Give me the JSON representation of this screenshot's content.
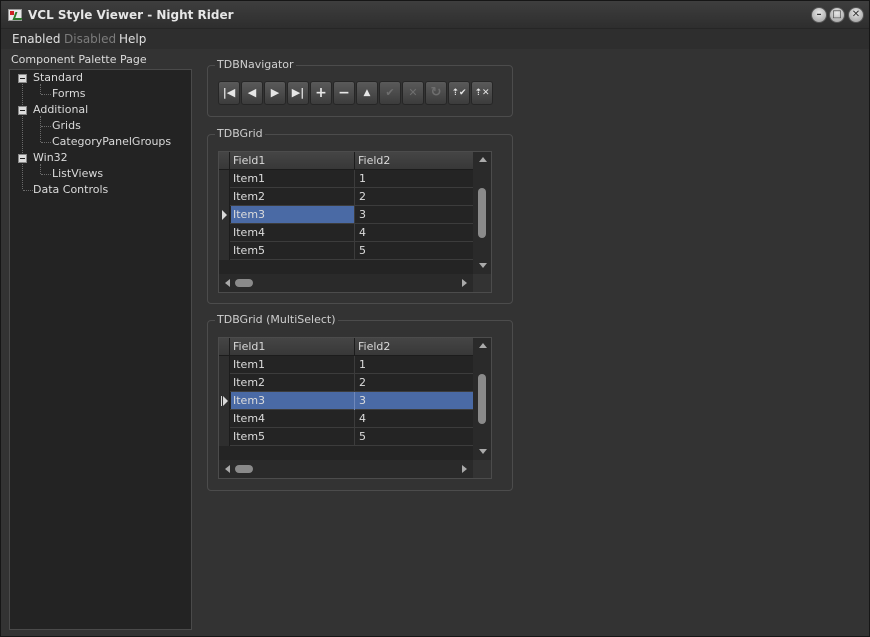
{
  "window": {
    "title": "VCL Style Viewer - Night Rider",
    "icon": "app-icon",
    "caption_buttons": {
      "minimize": "–",
      "maximize": "□",
      "close": "✕"
    }
  },
  "menu": {
    "items": [
      "Enabled",
      "Disabled",
      "Help"
    ]
  },
  "palette": {
    "label": "Component Palette Page",
    "tree": {
      "standard": {
        "label": "Standard",
        "children": [
          "Forms"
        ]
      },
      "additional": {
        "label": "Additional",
        "children": [
          "Grids",
          "CategoryPanelGroups"
        ]
      },
      "win32": {
        "label": "Win32",
        "children": [
          "ListViews"
        ]
      },
      "data_controls": {
        "label": "Data Controls"
      }
    }
  },
  "navigator": {
    "title": "TDBNavigator",
    "buttons": [
      {
        "name": "first",
        "glyph": "|◀",
        "enabled": true
      },
      {
        "name": "prior",
        "glyph": "◀",
        "enabled": true
      },
      {
        "name": "next",
        "glyph": "▶",
        "enabled": true
      },
      {
        "name": "last",
        "glyph": "▶|",
        "enabled": true
      },
      {
        "name": "insert",
        "glyph": "+",
        "enabled": true
      },
      {
        "name": "delete",
        "glyph": "−",
        "enabled": true
      },
      {
        "name": "edit",
        "glyph": "▲",
        "enabled": true
      },
      {
        "name": "post",
        "glyph": "✔",
        "enabled": false
      },
      {
        "name": "cancel",
        "glyph": "✕",
        "enabled": false
      },
      {
        "name": "refresh",
        "glyph": "↻",
        "enabled": false
      },
      {
        "name": "apply-updates",
        "glyph": "⇡✔",
        "enabled": true
      },
      {
        "name": "cancel-updates",
        "glyph": "⇡✕",
        "enabled": true
      }
    ]
  },
  "dbgrid": {
    "title": "TDBGrid",
    "columns": [
      "Field1",
      "Field2"
    ],
    "rows": [
      {
        "field1": "Item1",
        "field2": "1"
      },
      {
        "field1": "Item2",
        "field2": "2"
      },
      {
        "field1": "Item3",
        "field2": "3"
      },
      {
        "field1": "Item4",
        "field2": "4"
      },
      {
        "field1": "Item5",
        "field2": "5"
      }
    ],
    "selected_row": 2
  },
  "dbgrid_multi": {
    "title": "TDBGrid (MultiSelect)",
    "columns": [
      "Field1",
      "Field2"
    ],
    "rows": [
      {
        "field1": "Item1",
        "field2": "1"
      },
      {
        "field1": "Item2",
        "field2": "2"
      },
      {
        "field1": "Item3",
        "field2": "3"
      },
      {
        "field1": "Item4",
        "field2": "4"
      },
      {
        "field1": "Item5",
        "field2": "5"
      }
    ],
    "selected_row": 2
  },
  "colors": {
    "selection": "#4a6aa5",
    "background": "#333333"
  }
}
